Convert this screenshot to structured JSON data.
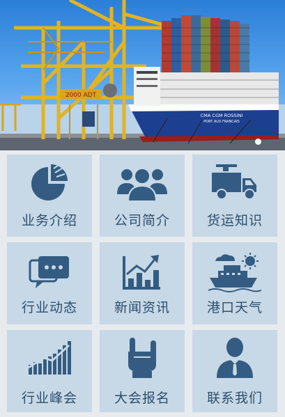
{
  "banner": {
    "ship_name": "CMA CGM ROSSINI",
    "ship_port": "PORT AUX FRANCAIS",
    "crane_sign": "2000 ADT",
    "slide_count": 1,
    "active_slide": 1
  },
  "menu": [
    {
      "label": "业务介绍",
      "icon": "pie-chart-icon"
    },
    {
      "label": "公司简介",
      "icon": "people-group-icon"
    },
    {
      "label": "货运知识",
      "icon": "delivery-truck-icon"
    },
    {
      "label": "行业动态",
      "icon": "chat-bubble-icon"
    },
    {
      "label": "新闻资讯",
      "icon": "bar-chart-growth-icon"
    },
    {
      "label": "港口天气",
      "icon": "cruise-ship-weather-icon"
    },
    {
      "label": "行业峰会",
      "icon": "rising-bars-icon"
    },
    {
      "label": "大会报名",
      "icon": "hand-gesture-icon"
    },
    {
      "label": "联系我们",
      "icon": "businessman-icon"
    }
  ],
  "colors": {
    "tile_bg": "#c7d8e6",
    "icon": "#345c82",
    "label": "#2e4f6e",
    "page_bg": "#e8ebee"
  }
}
